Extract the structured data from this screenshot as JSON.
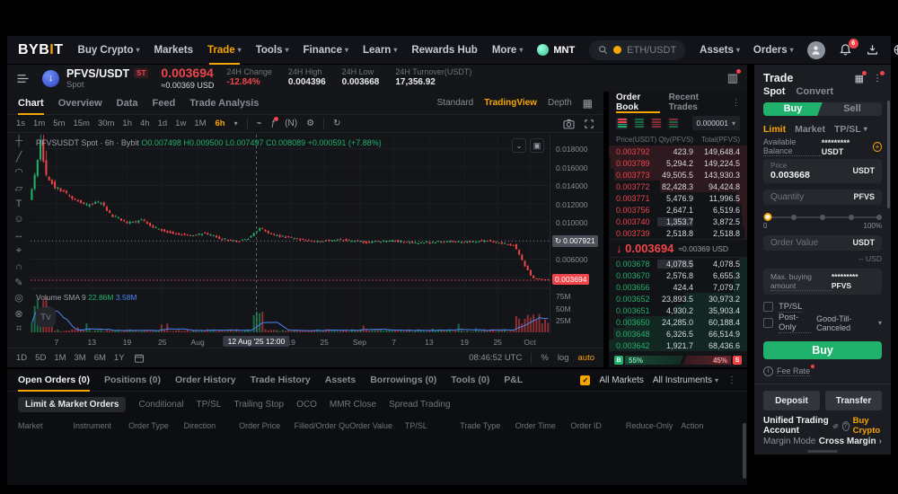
{
  "nav": {
    "logo": "BYBIT",
    "left_items": [
      {
        "label": "Buy Crypto",
        "caret": true
      },
      {
        "label": "Markets",
        "caret": false
      },
      {
        "label": "Trade",
        "caret": true,
        "active": true
      },
      {
        "label": "Tools",
        "caret": true
      },
      {
        "label": "Finance",
        "caret": true
      },
      {
        "label": "Learn",
        "caret": true
      },
      {
        "label": "Rewards Hub",
        "caret": false
      },
      {
        "label": "More",
        "caret": true
      }
    ],
    "mnt_label": "MNT",
    "search_pair": "ETH/USDT",
    "assets_label": "Assets",
    "orders_label": "Orders",
    "bell_badge": "6"
  },
  "ticker": {
    "pair": "PFVS/USDT",
    "badge": "ST",
    "market": "Spot",
    "price": "0.003694",
    "usd": "≈0.00369 USD",
    "stats": [
      {
        "label": "24H Change",
        "value": "-12.84%",
        "down": true
      },
      {
        "label": "24H High",
        "value": "0.004396",
        "down": false
      },
      {
        "label": "24H Low",
        "value": "0.003668",
        "down": false
      },
      {
        "label": "24H Turnover(USDT)",
        "value": "17,356.92",
        "down": false
      }
    ]
  },
  "chart": {
    "tabs": [
      {
        "label": "Chart",
        "active": true
      },
      {
        "label": "Overview"
      },
      {
        "label": "Data"
      },
      {
        "label": "Feed"
      },
      {
        "label": "Trade Analysis"
      }
    ],
    "view_modes": [
      {
        "label": "Standard"
      },
      {
        "label": "TradingView",
        "active": true
      },
      {
        "label": "Depth"
      }
    ],
    "timeframes": [
      "1s",
      "1m",
      "5m",
      "15m",
      "30m",
      "1h",
      "4h",
      "1d",
      "1w",
      "1M"
    ],
    "active_timeframe": "6h",
    "legend": {
      "title": "PFVSUSDT Spot · 6h · Bybit",
      "o": "O0.007498",
      "h": "H0.009500",
      "l": "L0.007497",
      "c": "C0.008089",
      "change": "+0.000591 (+7.88%)"
    },
    "volume_legend": {
      "label": "Volume SMA 9",
      "vol": "22.86M",
      "sma": "3.58M"
    },
    "price_axis": [
      "0.018000",
      "0.016000",
      "0.014000",
      "0.012000",
      "0.010000",
      "0.008000",
      "0.006000",
      "0.004000"
    ],
    "price_tags": {
      "last_line": {
        "label": "0.007921",
        "value": 0.007921
      },
      "current": {
        "label": "0.003694",
        "value": 0.003694
      }
    },
    "volume_axis": [
      "75M",
      "50M",
      "25M"
    ],
    "date_axis": [
      {
        "label": "7",
        "f": 0.05
      },
      {
        "label": "13",
        "f": 0.118
      },
      {
        "label": "19",
        "f": 0.186
      },
      {
        "label": "25",
        "f": 0.254
      },
      {
        "label": "Aug",
        "f": 0.322
      },
      {
        "label": "7",
        "f": 0.39
      },
      {
        "label": "19",
        "f": 0.502
      },
      {
        "label": "25",
        "f": 0.566
      },
      {
        "label": "Sep",
        "f": 0.634
      },
      {
        "label": "7",
        "f": 0.7
      },
      {
        "label": "13",
        "f": 0.768
      },
      {
        "label": "19",
        "f": 0.836
      },
      {
        "label": "25",
        "f": 0.9
      },
      {
        "label": "Oct",
        "f": 0.962
      }
    ],
    "crosshair": {
      "f": 0.435,
      "tooltip": "12 Aug '25 12:00"
    },
    "range_buttons": [
      "1D",
      "5D",
      "1M",
      "3M",
      "6M",
      "1Y"
    ],
    "clock": "08:46:52 UTC",
    "scale_controls": [
      {
        "label": "%"
      },
      {
        "label": "log"
      },
      {
        "label": "auto",
        "active": true
      }
    ],
    "tools": [
      {
        "glyph": "┼",
        "name": "crosshair-tool-icon"
      },
      {
        "glyph": "╱",
        "name": "trendline-tool-icon"
      },
      {
        "glyph": "◠",
        "name": "fib-tool-icon"
      },
      {
        "glyph": "▱",
        "name": "pattern-tool-icon"
      },
      {
        "glyph": "T",
        "name": "text-tool-icon"
      },
      {
        "glyph": "☺",
        "name": "emoji-tool-icon"
      },
      {
        "glyph": "↔",
        "name": "measure-tool-icon"
      },
      {
        "glyph": "⌖",
        "name": "zoom-tool-icon"
      },
      {
        "glyph": "∩",
        "name": "magnet-tool-icon"
      },
      {
        "glyph": "✎",
        "name": "draw-tool-icon"
      },
      {
        "glyph": "◎",
        "name": "hide-tool-icon"
      },
      {
        "glyph": "⊗",
        "name": "remove-tool-icon"
      },
      {
        "glyph": "⌗",
        "name": "more-tool-icon"
      }
    ],
    "price_path": [
      [
        0,
        0.0125
      ],
      [
        0.012,
        0.0152
      ],
      [
        0.022,
        0.019
      ],
      [
        0.032,
        0.0152
      ],
      [
        0.05,
        0.0138
      ],
      [
        0.08,
        0.0128
      ],
      [
        0.11,
        0.0118
      ],
      [
        0.135,
        0.0122
      ],
      [
        0.16,
        0.0107
      ],
      [
        0.19,
        0.0099
      ],
      [
        0.215,
        0.0102
      ],
      [
        0.25,
        0.0092
      ],
      [
        0.28,
        0.0088
      ],
      [
        0.31,
        0.0085
      ],
      [
        0.34,
        0.0088
      ],
      [
        0.37,
        0.0082
      ],
      [
        0.4,
        0.0079
      ],
      [
        0.425,
        0.0083
      ],
      [
        0.445,
        0.0094
      ],
      [
        0.465,
        0.0087
      ],
      [
        0.5,
        0.0083
      ],
      [
        0.55,
        0.0079
      ],
      [
        0.6,
        0.0081
      ],
      [
        0.65,
        0.0078
      ],
      [
        0.7,
        0.008
      ],
      [
        0.75,
        0.0077
      ],
      [
        0.8,
        0.0079
      ],
      [
        0.84,
        0.0078
      ],
      [
        0.88,
        0.008
      ],
      [
        0.91,
        0.0077
      ],
      [
        0.935,
        0.0075
      ],
      [
        0.955,
        0.0053
      ],
      [
        0.97,
        0.0039
      ],
      [
        1,
        0.0037
      ]
    ]
  },
  "orderbook": {
    "tabs": [
      {
        "label": "Order Book",
        "active": true
      },
      {
        "label": "Recent Trades"
      }
    ],
    "precision": "0.000001",
    "columns": {
      "price": "Price(USDT)",
      "qty": "Qty(PFVS)",
      "total": "Total(PFVS)"
    },
    "asks": [
      {
        "price": "0.003792",
        "qty": "423.9",
        "total": "149,648.4",
        "depth": 100,
        "flash": false
      },
      {
        "price": "0.003789",
        "qty": "5,294.2",
        "total": "149,224.5",
        "depth": 99,
        "flash": false
      },
      {
        "price": "0.003773",
        "qty": "49,505.5",
        "total": "143,930.3",
        "depth": 96,
        "flash": false
      },
      {
        "price": "0.003772",
        "qty": "82,428.3",
        "total": "94,424.8",
        "depth": 63,
        "flash": false
      },
      {
        "price": "0.003771",
        "qty": "5,476.9",
        "total": "11,996.5",
        "depth": 8,
        "flash": false
      },
      {
        "price": "0.003756",
        "qty": "2,647.1",
        "total": "6,519.6",
        "depth": 4,
        "flash": false
      },
      {
        "price": "0.003740",
        "qty": "1,353.7",
        "total": "3,872.5",
        "depth": 3,
        "flash": true
      },
      {
        "price": "0.003739",
        "qty": "2,518.8",
        "total": "2,518.8",
        "depth": 2,
        "flash": false
      }
    ],
    "mid": {
      "arrow": "↓",
      "price": "0.003694",
      "usd": "≈0.00369 USD"
    },
    "bids": [
      {
        "price": "0.003678",
        "qty": "4,078.5",
        "total": "4,078.5",
        "depth": 6,
        "flash": true
      },
      {
        "price": "0.003670",
        "qty": "2,576.8",
        "total": "6,655.3",
        "depth": 10,
        "flash": false
      },
      {
        "price": "0.003656",
        "qty": "424.4",
        "total": "7,079.7",
        "depth": 10,
        "flash": false
      },
      {
        "price": "0.003652",
        "qty": "23,893.5",
        "total": "30,973.2",
        "depth": 45,
        "flash": false
      },
      {
        "price": "0.003651",
        "qty": "4,930.2",
        "total": "35,903.4",
        "depth": 52,
        "flash": false
      },
      {
        "price": "0.003650",
        "qty": "24,285.0",
        "total": "60,188.4",
        "depth": 88,
        "flash": false
      },
      {
        "price": "0.003648",
        "qty": "6,326.5",
        "total": "66,514.9",
        "depth": 97,
        "flash": false
      },
      {
        "price": "0.003642",
        "qty": "1,921.7",
        "total": "68,436.6",
        "depth": 100,
        "flash": false
      }
    ],
    "ratio": {
      "buy_chip": "B",
      "buy_pct": "55%",
      "sell_pct": "45%",
      "sell_chip": "S",
      "buy_width": 55,
      "sell_width": 45
    }
  },
  "trade_panel": {
    "title": "Trade",
    "tabs": [
      {
        "label": "Spot",
        "active": true
      },
      {
        "label": "Convert"
      }
    ],
    "buy_label": "Buy",
    "sell_label": "Sell",
    "order_types": [
      {
        "label": "Limit",
        "active": true,
        "caret": false
      },
      {
        "label": "Market",
        "caret": false
      },
      {
        "label": "TP/SL",
        "caret": true
      }
    ],
    "available_balance": {
      "label": "Available Balance",
      "value": "********* USDT"
    },
    "price_field": {
      "label": "Price",
      "value": "0.003668",
      "unit": "USDT"
    },
    "qty_field": {
      "placeholder": "Quantity",
      "unit": "PFVS"
    },
    "slider": {
      "min": "0",
      "max": "100%"
    },
    "value_field": {
      "placeholder": "Order Value",
      "unit": "USDT"
    },
    "usd_hint": "-- USD",
    "max_buy": {
      "label": "Max. buying amount",
      "value": "********* PFVS"
    },
    "tpsl_label": "TP/SL",
    "post_only_label": "Post-Only",
    "tif": "Good-Till-Canceled",
    "submit_label": "Buy",
    "fee_label": "Fee Rate",
    "deposit_label": "Deposit",
    "transfer_label": "Transfer",
    "account": {
      "label": "Unified Trading Account",
      "buy_crypto": "Buy Crypto"
    },
    "margin": {
      "label": "Margin Mode",
      "value": "Cross Margin"
    }
  },
  "bottom": {
    "tabs": [
      {
        "label": "Open Orders (0)",
        "active": true
      },
      {
        "label": "Positions (0)"
      },
      {
        "label": "Order History"
      },
      {
        "label": "Trade History"
      },
      {
        "label": "Assets"
      },
      {
        "label": "Borrowings (0)"
      },
      {
        "label": "Tools (0)"
      },
      {
        "label": "P&L"
      }
    ],
    "filters": {
      "all_markets": "All Markets",
      "all_instruments": "All Instruments"
    },
    "subtabs": [
      {
        "label": "Limit & Market Orders",
        "active": true
      },
      {
        "label": "Conditional"
      },
      {
        "label": "TP/SL"
      },
      {
        "label": "Trailing Stop"
      },
      {
        "label": "OCO"
      },
      {
        "label": "MMR Close"
      },
      {
        "label": "Spread Trading"
      }
    ],
    "columns": [
      "Market",
      "Instrument",
      "Order Type",
      "Direction",
      "Order Price",
      "Filled/Order Quantity",
      "Order Value",
      "TP/SL",
      "Trade Type",
      "Order Time",
      "Order ID",
      "Reduce-Only",
      "Action"
    ]
  },
  "colors": {
    "accent": "#f7a600",
    "up": "#20b26c",
    "down": "#ef454a",
    "sma_line": "#4a86f7"
  }
}
